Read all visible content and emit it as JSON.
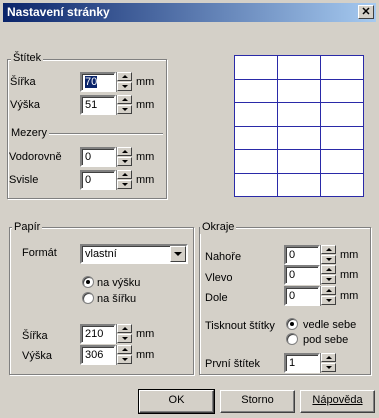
{
  "window": {
    "title": "Nastavení stránky",
    "close_glyph": "✕"
  },
  "label_group": {
    "title": "Štítek",
    "width_label": "Šířka",
    "width_value_selected": "70",
    "width_unit": "mm",
    "height_label": "Výška",
    "height_value": "51",
    "height_unit": "mm",
    "spacing_title": "Mezery",
    "horizontal_label": "Vodorovně",
    "horizontal_value": "0",
    "horizontal_unit": "mm",
    "vertical_label": "Svisle",
    "vertical_value": "0",
    "vertical_unit": "mm"
  },
  "paper_group": {
    "title": "Papír",
    "format_label": "Formát",
    "format_value": "vlastní",
    "orientation_portrait": "na výšku",
    "orientation_landscape": "na šířku",
    "orientation_selected": "portrait",
    "width_label": "Šířka",
    "width_value": "210",
    "width_unit": "mm",
    "height_label": "Výška",
    "height_value": "306",
    "height_unit": "mm"
  },
  "margins_group": {
    "title": "Okraje",
    "top_label": "Nahoře",
    "top_value": "0",
    "top_unit": "mm",
    "left_label": "Vlevo",
    "left_value": "0",
    "left_unit": "mm",
    "bottom_label": "Dole",
    "bottom_value": "0",
    "bottom_unit": "mm",
    "print_labels_label": "Tisknout štítky",
    "print_side_by_side": "vedle sebe",
    "print_below": "pod sebe",
    "print_selected": "side_by_side",
    "first_label_label": "První štítek",
    "first_label_value": "1"
  },
  "preview": {
    "columns": 3,
    "rows": 6,
    "line_color": "#2a2aa8"
  },
  "buttons": {
    "ok": "OK",
    "cancel": "Storno",
    "help": "Nápověda"
  },
  "colors": {
    "face": "#d4d0c8",
    "title_start": "#0a246a",
    "title_end": "#a6caf0"
  }
}
